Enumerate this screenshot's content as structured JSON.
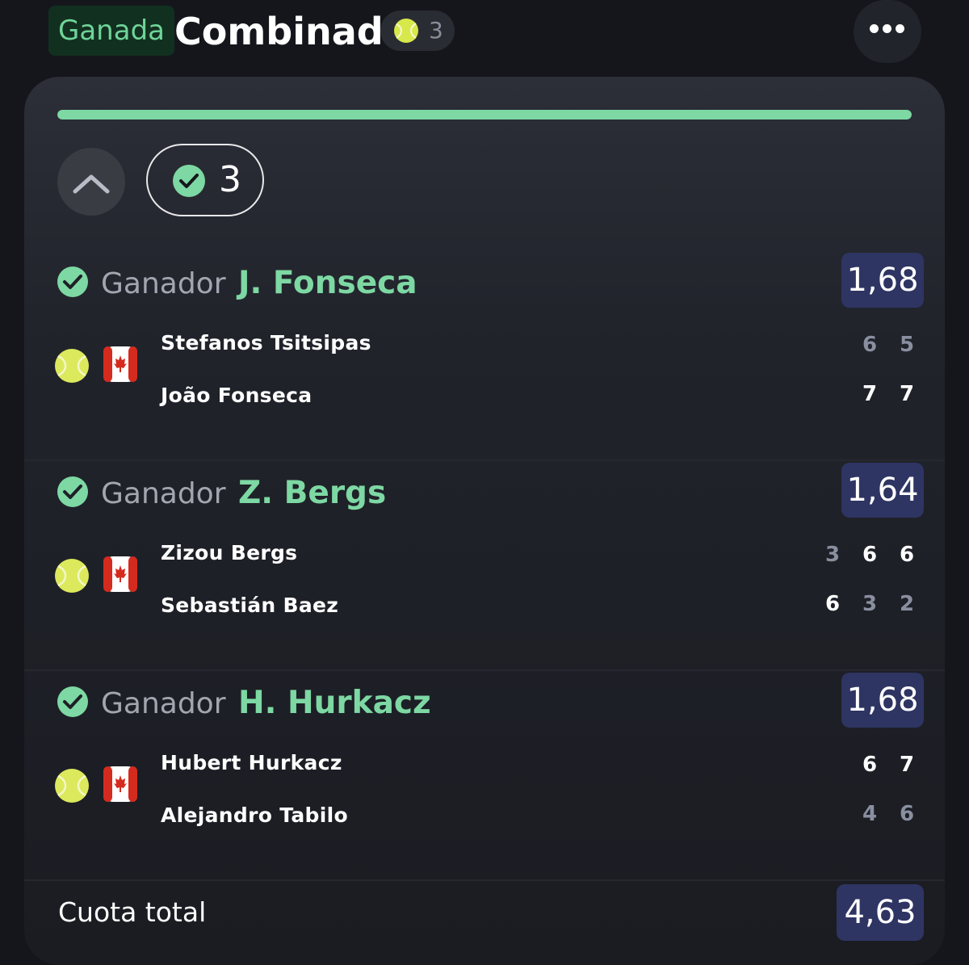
{
  "header": {
    "status": "Ganada",
    "title": "Combinada",
    "sport_count": "3",
    "more_icon": "more-horizontal-icon"
  },
  "progress": {
    "won_fraction": 1.0
  },
  "summary": {
    "won_count": "3"
  },
  "legs": [
    {
      "market": "Ganador",
      "pick": "J. Fonseca",
      "odds": "1,68",
      "players": [
        "Stefanos Tsitsipas",
        "João Fonseca"
      ],
      "scores": [
        [
          "6",
          "5"
        ],
        [
          "7",
          "7"
        ]
      ],
      "winner": 1
    },
    {
      "market": "Ganador",
      "pick": "Z. Bergs",
      "odds": "1,64",
      "players": [
        "Zizou Bergs",
        "Sebastián Baez"
      ],
      "scores": [
        [
          "3",
          "6",
          "6"
        ],
        [
          "6",
          "3",
          "2"
        ]
      ],
      "winner": 0
    },
    {
      "market": "Ganador",
      "pick": "H. Hurkacz",
      "odds": "1,68",
      "players": [
        "Hubert Hurkacz",
        "Alejandro Tabilo"
      ],
      "scores": [
        [
          "6",
          "7"
        ],
        [
          "4",
          "6"
        ]
      ],
      "winner": 0
    }
  ],
  "total": {
    "label": "Cuota total",
    "odds": "4,63"
  },
  "colors": {
    "accent_green": "#7dd8a3",
    "odds_bg": "#2e3563",
    "background": "#15161c"
  }
}
